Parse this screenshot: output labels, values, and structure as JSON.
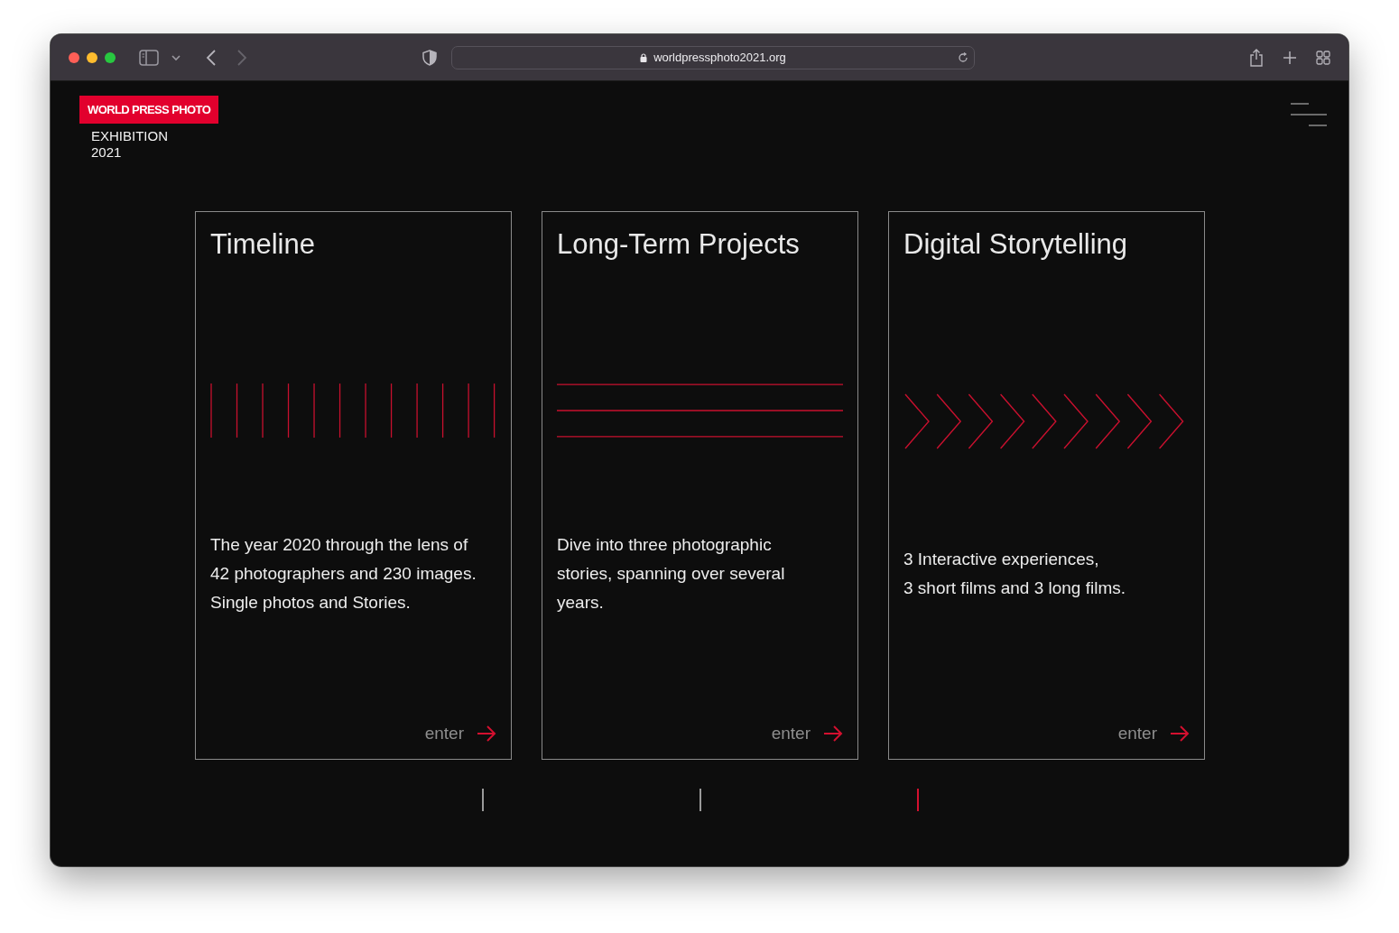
{
  "browser": {
    "url": "worldpressphoto2021.org"
  },
  "logo": {
    "wordmark": "WORLD PRESS PHOTO",
    "subtitle_lines": [
      "EXHIBITION",
      "2021"
    ]
  },
  "cards": [
    {
      "title": "Timeline",
      "kind": "vertical-lines",
      "description_lines": [
        "The year 2020 through the lens of",
        "42 photographers and 230 images.",
        "Single photos and Stories."
      ],
      "action": "enter"
    },
    {
      "title": "Long-Term Projects",
      "kind": "horizontal-lines",
      "description_lines": [
        "Dive into three photographic",
        "stories, spanning over several",
        "years."
      ],
      "action": "enter"
    },
    {
      "title": "Digital Storytelling",
      "kind": "chevrons",
      "description_lines": [
        "3 Interactive experiences,",
        "3 short films and 3 long films."
      ],
      "action": "enter"
    }
  ],
  "pager": [
    {
      "selected": false
    },
    {
      "selected": false
    },
    {
      "selected": true
    }
  ]
}
